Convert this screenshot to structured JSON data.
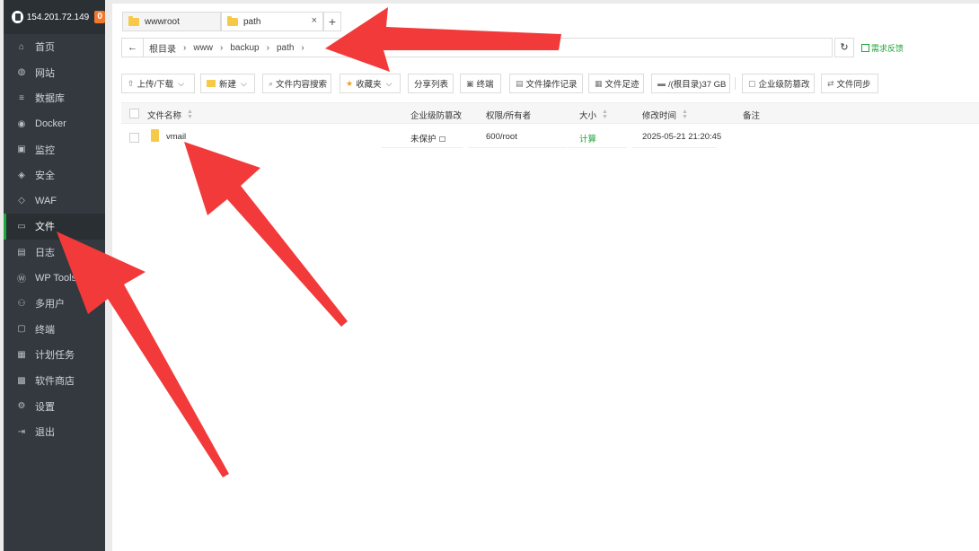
{
  "sidebar": {
    "ip": "154.201.72.149",
    "badge": "0",
    "items": [
      {
        "label": "首页",
        "icon": "home-icon",
        "glyph": "⌂"
      },
      {
        "label": "网站",
        "icon": "globe-icon",
        "glyph": "◍"
      },
      {
        "label": "数据库",
        "icon": "database-icon",
        "glyph": "≡"
      },
      {
        "label": "Docker",
        "icon": "docker-icon",
        "glyph": "◉"
      },
      {
        "label": "监控",
        "icon": "monitor-icon",
        "glyph": "▣"
      },
      {
        "label": "安全",
        "icon": "shield-icon",
        "glyph": "◈"
      },
      {
        "label": "WAF",
        "icon": "waf-shield-icon",
        "glyph": "◇"
      },
      {
        "label": "文件",
        "icon": "folder-icon",
        "glyph": "▭"
      },
      {
        "label": "日志",
        "icon": "log-icon",
        "glyph": "▤"
      },
      {
        "label": "WP Tools",
        "icon": "wordpress-icon",
        "glyph": "Ⓦ"
      },
      {
        "label": "多用户",
        "icon": "users-icon",
        "glyph": "⚇"
      },
      {
        "label": "终端",
        "icon": "terminal-icon",
        "glyph": "▢"
      },
      {
        "label": "计划任务",
        "icon": "calendar-icon",
        "glyph": "▦"
      },
      {
        "label": "软件商店",
        "icon": "store-icon",
        "glyph": "▩"
      },
      {
        "label": "设置",
        "icon": "gear-icon",
        "glyph": "⚙"
      },
      {
        "label": "退出",
        "icon": "logout-icon",
        "glyph": "⇥"
      }
    ],
    "active_index": 7
  },
  "tabs": [
    {
      "label": "wwwroot",
      "active": false
    },
    {
      "label": "path",
      "active": true,
      "close": "×"
    }
  ],
  "tab_add": "+",
  "address": {
    "back": "←",
    "crumbs": [
      "根目录",
      "www",
      "backup",
      "path"
    ],
    "sep": "›",
    "refresh": "↻"
  },
  "feedback_label": "需求反馈",
  "toolbar": {
    "upload": "上传/下载",
    "new": "新建",
    "search": "文件内容搜索",
    "favorites": "收藏夹",
    "share": "分享列表",
    "terminal": "终端",
    "oplog": "文件操作记录",
    "footprint": "文件足迹",
    "disk": "/(根目录)37 GB",
    "tamper": "企业级防篡改",
    "sync": "文件同步"
  },
  "table": {
    "headers": {
      "name": "文件名称",
      "protect": "企业级防篡改",
      "perm": "权限/所有者",
      "size": "大小",
      "mtime": "修改时间",
      "note": "备注"
    },
    "rows": [
      {
        "name": "vmail",
        "protect": "未保护",
        "perm": "600/root",
        "size": "计算",
        "mtime": "2025-05-21 21:20:45",
        "note": ""
      }
    ]
  },
  "colors": {
    "sidebar_bg": "#33393f",
    "accent_green": "#20a53a",
    "badge_orange": "#f0792e",
    "arrow_red": "#f23a3a"
  }
}
